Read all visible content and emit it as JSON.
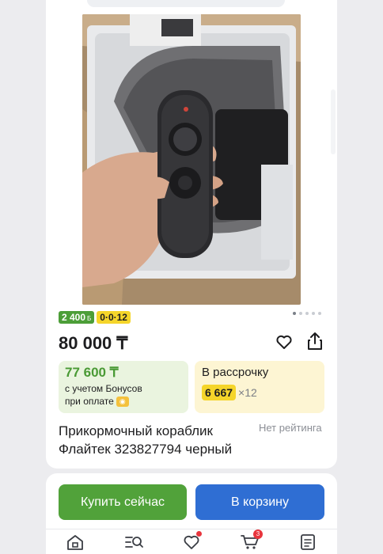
{
  "carousel": {
    "slides": 5,
    "active": 0
  },
  "badges": {
    "bonus": "2 400",
    "bonus_symbol": "Б",
    "installment": "0·0·12"
  },
  "product": {
    "price": "80 000 ₸",
    "title_line1": "Прикормочный кораблик",
    "title_line2": "Флайтек 323827794 черный",
    "rating": "Нет рейтинга"
  },
  "bonus_offer": {
    "price": "77 600 ₸",
    "note_line1": "с учетом Бонусов",
    "note_line2": "при оплате"
  },
  "installment": {
    "label": "В рассрочку",
    "amount": "6 667",
    "months": "×12"
  },
  "actions": {
    "buy": "Купить сейчас",
    "cart": "В корзину"
  },
  "nav": {
    "cart_count": "3"
  },
  "icons": {
    "favorite": "heart-icon",
    "share": "share-icon",
    "home": "home-icon",
    "catalog": "catalog-search-icon",
    "favorites": "heart-icon",
    "cart": "cart-icon",
    "orders": "orders-icon",
    "bonus_coin": "kaspi-coin-icon"
  },
  "colors": {
    "green": "#51a23a",
    "blue": "#2f6ed3",
    "yellow": "#f5d52a",
    "badge_red": "#e8353d"
  }
}
